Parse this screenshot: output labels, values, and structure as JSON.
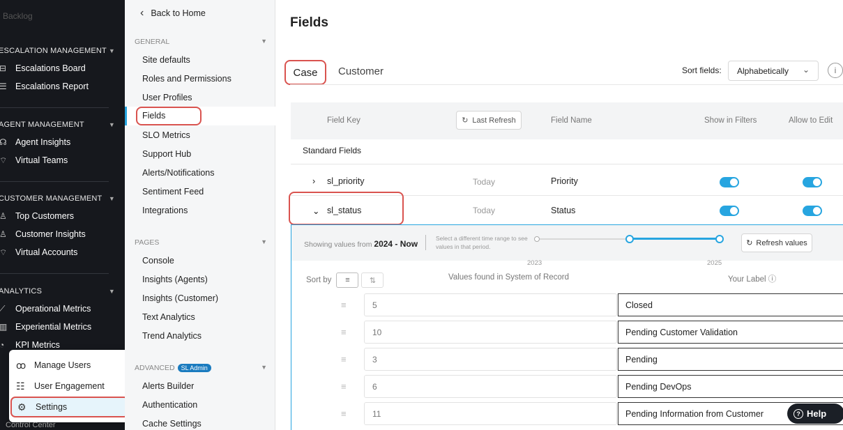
{
  "nav": {
    "faded_top": "Backlog",
    "sections": [
      {
        "title": "ESCALATION MANAGEMENT",
        "items": [
          "Escalations Board",
          "Escalations Report"
        ]
      },
      {
        "title": "AGENT MANAGEMENT",
        "items": [
          "Agent Insights",
          "Virtual Teams"
        ]
      },
      {
        "title": "CUSTOMER MANAGEMENT",
        "items": [
          "Top Customers",
          "Customer Insights",
          "Virtual Accounts"
        ]
      },
      {
        "title": "ANALYTICS",
        "items": [
          "Operational Metrics",
          "Experiential Metrics",
          "KPI Metrics"
        ]
      }
    ],
    "bottom": "Control Center"
  },
  "popup": {
    "items": [
      "Manage Users",
      "User Engagement",
      "Settings"
    ]
  },
  "submenu": {
    "back": "Back to Home",
    "general": {
      "title": "GENERAL",
      "items": [
        "Site defaults",
        "Roles and Permissions",
        "User Profiles",
        "Fields",
        "SLO Metrics",
        "Support Hub",
        "Alerts/Notifications",
        "Sentiment Feed",
        "Integrations"
      ]
    },
    "pages": {
      "title": "PAGES",
      "items": [
        "Console",
        "Insights (Agents)",
        "Insights (Customer)",
        "Text Analytics",
        "Trend Analytics"
      ]
    },
    "advanced": {
      "title": "ADVANCED",
      "badge": "SL Admin",
      "items": [
        "Alerts Builder",
        "Authentication",
        "Cache Settings"
      ]
    }
  },
  "main": {
    "title": "Fields",
    "tabs": [
      "Case",
      "Customer"
    ],
    "sort_label": "Sort fields:",
    "sort_value": "Alphabetically",
    "table_headers": {
      "field_key": "Field Key",
      "last_refresh": "Last Refresh",
      "field_name": "Field Name",
      "show_in_filters": "Show in Filters",
      "allow_to_edit": "Allow to Edit"
    },
    "standard_fields": "Standard Fields",
    "rows": [
      {
        "key": "sl_priority",
        "date": "Today",
        "name": "Priority",
        "show": true,
        "edit": true
      },
      {
        "key": "sl_status",
        "date": "Today",
        "name": "Status",
        "show": true,
        "edit": true
      }
    ],
    "range": {
      "showing": "Showing values from",
      "period": "2024 - Now",
      "help": "Select a different time range to see values in that period.",
      "year_start": "2023",
      "year_end": "2025",
      "start_fraction": 0.5,
      "end_fraction": 1.0,
      "refresh": "Refresh values"
    },
    "sort_by": "Sort by",
    "values_header": "Values found in System of Record",
    "label_header": "Your Label ⓘ",
    "values": [
      {
        "value": "5",
        "label": "Closed"
      },
      {
        "value": "10",
        "label": "Pending Customer Validation"
      },
      {
        "value": "3",
        "label": "Pending"
      },
      {
        "value": "6",
        "label": "Pending DevOps"
      },
      {
        "value": "11",
        "label": "Pending Information from Customer"
      }
    ]
  },
  "help": "Help",
  "colors": {
    "accent": "#27a5e0",
    "highlight": "#d9534f",
    "nav_bg": "#16181d"
  }
}
